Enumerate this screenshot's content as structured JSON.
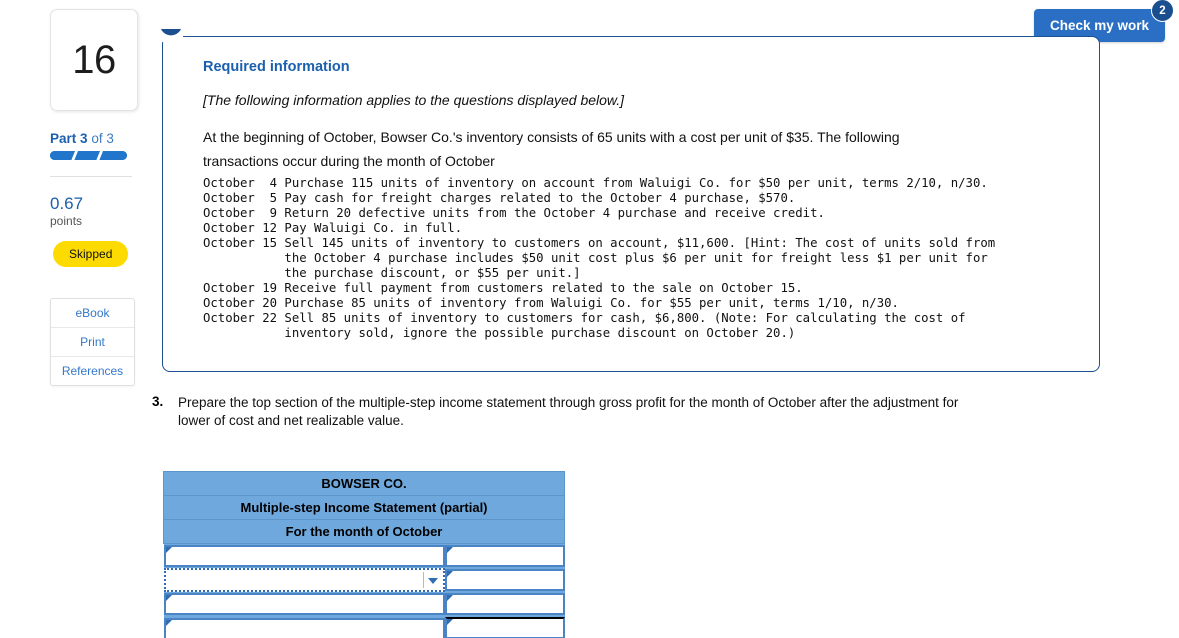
{
  "left_rail": {
    "question_number": "16",
    "part_label_prefix": "Part",
    "part_current": "3",
    "part_of": "of 3",
    "progress_segments": 3,
    "points_value": "0.67",
    "points_label": "points",
    "status_badge": "Skipped",
    "buttons": [
      {
        "label": "eBook",
        "name": "ebook-button"
      },
      {
        "label": "Print",
        "name": "print-button"
      },
      {
        "label": "References",
        "name": "references-button"
      }
    ]
  },
  "toolbar": {
    "check_my_work_label": "Check my work",
    "check_my_work_badge": "2",
    "check_button_color": "#2a6fc4",
    "badge_color": "#1a4f8f"
  },
  "required_information": {
    "title": "Required information",
    "subtitle": "[The following information applies to the questions displayed below.]",
    "intro_line_1": "At the beginning of October, Bowser Co.'s inventory consists of 65 units with a cost per unit of $35. The following",
    "intro_line_2": "transactions occur during the month of October",
    "transactions": "October  4 Purchase 115 units of inventory on account from Waluigi Co. for $50 per unit, terms 2/10, n/30.\nOctober  5 Pay cash for freight charges related to the October 4 purchase, $570.\nOctober  9 Return 20 defective units from the October 4 purchase and receive credit.\nOctober 12 Pay Waluigi Co. in full.\nOctober 15 Sell 145 units of inventory to customers on account, $11,600. [Hint: The cost of units sold from\n           the October 4 purchase includes $50 unit cost plus $6 per unit for freight less $1 per unit for\n           the purchase discount, or $55 per unit.]\nOctober 19 Receive full payment from customers related to the sale on October 15.\nOctober 20 Purchase 85 units of inventory from Waluigi Co. for $55 per unit, terms 1/10, n/30.\nOctober 22 Sell 85 units of inventory to customers for cash, $6,800. (Note: For calculating the cost of\n           inventory sold, ignore the possible purchase discount on October 20.)"
  },
  "question": {
    "number": "3.",
    "text_line_1": "Prepare the top section of the multiple-step income statement through gross profit for the month of October after the adjustment for",
    "text_line_2": "lower of cost and net realizable value."
  },
  "answer_table": {
    "header_color": "#6fa8dd",
    "headers": [
      "BOWSER CO.",
      "Multiple-step Income Statement (partial)",
      "For the month of October"
    ],
    "rows": [
      {
        "type": "text",
        "label_value": "",
        "amount_value": ""
      },
      {
        "type": "dropdown",
        "label_value": "",
        "amount_value": "",
        "focused": true
      },
      {
        "type": "text",
        "label_value": "",
        "amount_value": ""
      },
      {
        "type": "text",
        "label_value": "",
        "amount_value": "",
        "amount_top_rule": true,
        "amount_bottom_rule": true
      }
    ]
  }
}
